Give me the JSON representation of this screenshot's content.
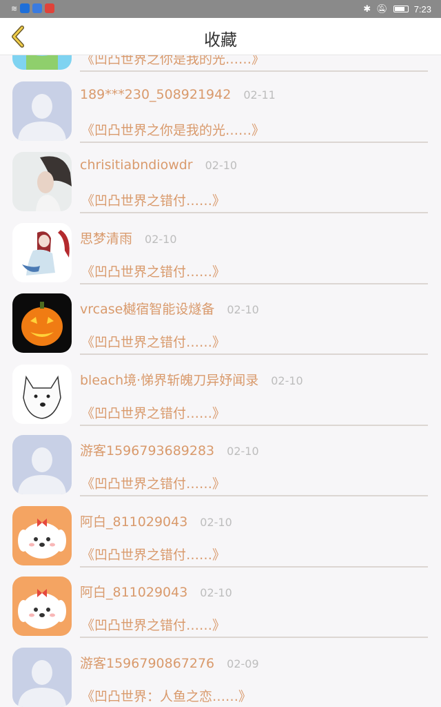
{
  "status_bar": {
    "time": "7:23"
  },
  "header": {
    "title": "收藏"
  },
  "items": [
    {
      "avatar": "cartoon-avatar",
      "username": "",
      "date": "",
      "title": "《凹凸世界之你是我的光……》"
    },
    {
      "avatar": "default-avatar",
      "username": "189***230_508921942",
      "date": "02-11",
      "title": "《凹凸世界之你是我的光……》"
    },
    {
      "avatar": "girl-photo-avatar",
      "username": "chrisitiabndiowdr",
      "date": "02-10",
      "title": "《凹凸世界之错付……》"
    },
    {
      "avatar": "anime-girl-avatar",
      "username": "思梦清雨",
      "date": "02-10",
      "title": "《凹凸世界之错付……》"
    },
    {
      "avatar": "pumpkin-avatar",
      "username": "vrcase樾宿智能设燧备",
      "date": "02-10",
      "title": "《凹凸世界之错付……》"
    },
    {
      "avatar": "doge-avatar",
      "username": "bleach境·悌界斩魄刀异妤闻录",
      "date": "02-10",
      "title": "《凹凸世界之错付……》"
    },
    {
      "avatar": "default-avatar",
      "username": "游客1596793689283",
      "date": "02-10",
      "title": "《凹凸世界之错付……》"
    },
    {
      "avatar": "puppy-avatar",
      "username": "阿白_811029043",
      "date": "02-10",
      "title": "《凹凸世界之错付……》"
    },
    {
      "avatar": "puppy-avatar",
      "username": "阿白_811029043",
      "date": "02-10",
      "title": "《凹凸世界之错付……》"
    },
    {
      "avatar": "default-avatar",
      "username": "游客1596790867276",
      "date": "02-09",
      "title": "《凹凸世界：人鱼之恋……》"
    }
  ]
}
